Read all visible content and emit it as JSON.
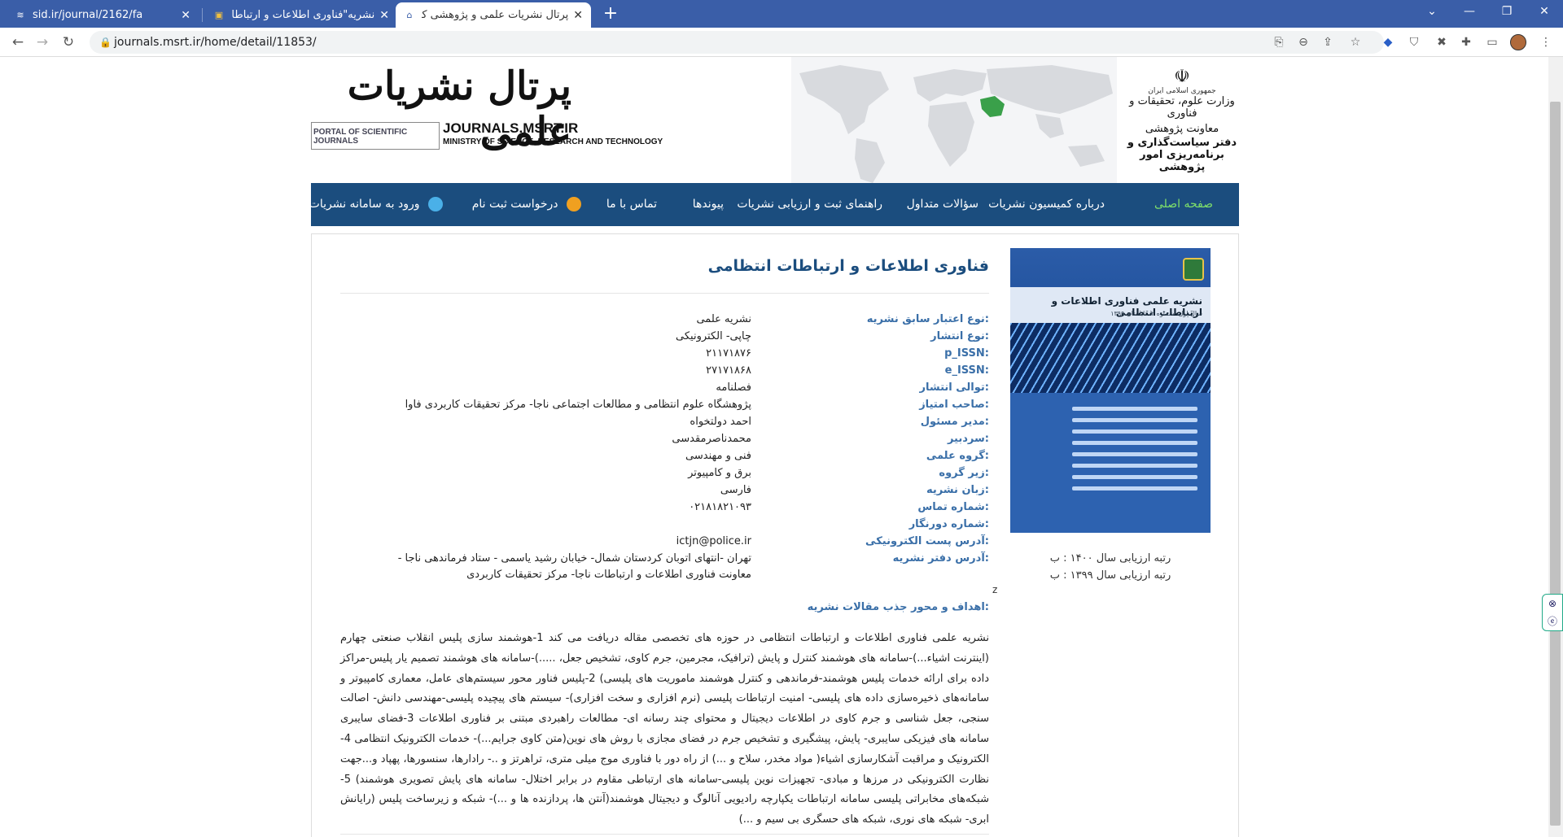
{
  "browser": {
    "tabs": [
      {
        "title": "sid.ir/journal/2162/fa",
        "icon": "sid-favicon"
      },
      {
        "title": "نشریه\"فناوری اطلاعات و ارتباطات ا...",
        "icon": "police-favicon"
      },
      {
        "title": "پرتال نشریات علمی و پژوهشی کشور",
        "icon": "portal-favicon"
      }
    ],
    "url": "journals.msrt.ir/home/detail/11853/"
  },
  "header": {
    "site_title": "پرتال نشریات علمی",
    "portal_box": "PORTAL OF SCIENTIFIC JOURNALS",
    "domain": "JOURNALS.MSRT.IR",
    "ministry": "MINISTRY OF SCIENCE, RESEARCH AND TECHNOLOGY",
    "emblem_l1": "جمهوری اسلامی ایران",
    "emblem_l2": "وزارت علوم، تحقیقات و فناوری",
    "emblem_l3": "معاونت پژوهشی",
    "emblem_l4": "دفتر سیاست‌گذاری و برنامه‌ریزی امور پژوهشی"
  },
  "nav": {
    "home": "صفحه اصلی",
    "about": "درباره کمیسیون نشریات",
    "faq": "سؤالات متداول",
    "guide": "راهنمای ثبت و ارزیابی نشریات",
    "links": "پیوندها",
    "contact": "تماس با ما",
    "register": "درخواست ثبت نام",
    "login": "ورود به سامانه نشریات"
  },
  "journal": {
    "title": "فناوری اطلاعات و ارتباطات انتظامی",
    "cover_title": "نشریه علمی فناوری اطلاعات و ارتباطات انتظامی",
    "cover_sub": "سال اول، شماره ۲، تابستان ۱۳۹۹",
    "fields": [
      {
        "label": "نوع اعتبار سابق نشریه:",
        "value": "نشریه علمی"
      },
      {
        "label": "نوع انتشار:",
        "value": "چاپی- الکترونیکی"
      },
      {
        "label": "p_ISSN:",
        "value": "۲۱۱۷۱۸۷۶"
      },
      {
        "label": "e_ISSN:",
        "value": "۲۷۱۷۱۸۶۸"
      },
      {
        "label": "توالی انتشار:",
        "value": "فصلنامه"
      },
      {
        "label": "صاحب امتیاز:",
        "value": "پژوهشگاه علوم انتظامی و مطالعات اجتماعی ناجا- مرکز تحقیقات کاربردی فاوا"
      },
      {
        "label": "مدیر مسئول:",
        "value": "احمد دولتخواه"
      },
      {
        "label": "سردبیر:",
        "value": "محمدناصرمقدسی"
      },
      {
        "label": "گروه علمی:",
        "value": "فنی و مهندسی"
      },
      {
        "label": "زیر گروه:",
        "value": "برق و کامپیوتر"
      },
      {
        "label": "زبان نشریه:",
        "value": "فارسی"
      },
      {
        "label": "شماره تماس:",
        "value": "۰۲۱۸۱۸۲۱۰۹۳"
      },
      {
        "label": "شماره دورنگار:",
        "value": ""
      },
      {
        "label": "آدرس پست الکترونیکی:",
        "value": "ictjn@police.ir"
      },
      {
        "label": "آدرس دفتر نشریه:",
        "value": "تهران -انتهای اتوبان کردستان شمال- خیابان رشید یاسمی - ستاد فرماندهی ناجا - معاونت فناوری اطلاعات و ارتباطات ناجا- مرکز تحقیقات کاربردی"
      }
    ],
    "z_mark": "z",
    "aims_label": "اهداف و محور جذب مقالات نشریه:",
    "aims_text": "نشریه علمی فناوری اطلاعات و ارتباطات انتظامی در حوزه های تخصصی مقاله دریافت می کند 1-هوشمند سازی پلیس انقلاب صنعتی چهارم (اینترنت اشیاء...)-سامانه های هوشمند کنترل و پایش (ترافیک، مجرمین، جرم کاوی، تشخیص جعل، .....)-سامانه های هوشمند تصمیم یار پلیس-مراکز داده برای ارائه خدمات پلیس هوشمند-فرماندهی و کنترل هوشمند ماموریت های پلیسی) 2-پلیس فناور محور سیستم‌های عامل، معماری کامپیوتر و سامانه‌های ذخیره‌سازی داده های پلیسی- امنیت ارتباطات پلیسی (نرم افزاری و سخت افزاری)- سیستم های پیچیده پلیسی-مهندسی دانش- اصالت سنجی، جعل شناسی و جرم کاوی در اطلاعات دیجیتال و محتوای چند رسانه ای- مطالعات راهبردی مبتنی بر فناوری اطلاعات 3-فضای سایبری سامانه های فیزیکی سایبری- پایش، پیشگیری و تشخیص جرم در فضای مجازی با روش های نوین(متن کاوی جرایم...)- خدمات الکترونیک انتظامی 4-الکترونیک و مراقبت آشکارسازی اشیاء( مواد مخدر، سلاح و ...) از راه دور با فناوری موج میلی متری، تراهرتز و ..- رادارها، سنسورها، پهپاد و...جهت نظارت الکترونیکی در مرزها و مبادی- تجهیزات نوین پلیسی-سامانه های ارتباطی مقاوم در برابر اختلال- سامانه های پایش تصویری هوشمند) 5-شبکه‌های مخابراتی پلیسی سامانه ارتباطات یکپارچه رادیویی آنالوگ و دیجیتال هوشمند(آنتن ها، پردازنده ها و ...)- شبکه و زیرساخت پلیس (رایانش ابری- شبکه های نوری، شبکه های حسگری بی سیم و ...)"
  },
  "ranks": [
    "رتبه ارزیابی سال ۱۴۰۰ : ب",
    "رتبه ارزیابی سال ۱۳۹۹ : ب"
  ]
}
